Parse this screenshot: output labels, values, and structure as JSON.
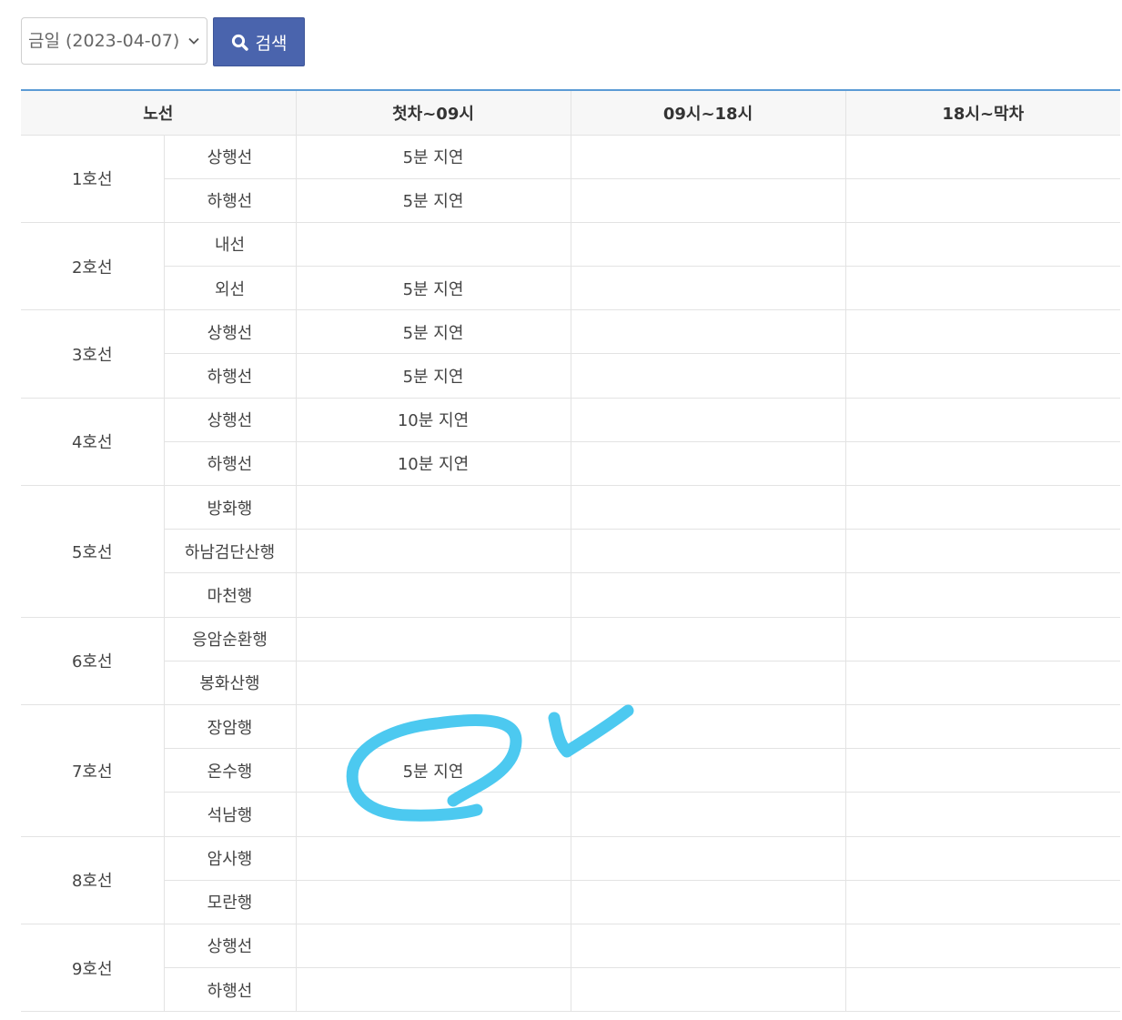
{
  "search": {
    "selected_value": "금일 (2023-04-07)",
    "button_label": "검색"
  },
  "table": {
    "headers": [
      "노선",
      "첫차~09시",
      "09시~18시",
      "18시~막차"
    ],
    "lines": [
      {
        "name": "1호선",
        "directions": [
          {
            "direction": "상행선",
            "first_to_09": "5분 지연",
            "h09_to_18": "",
            "h18_to_last": ""
          },
          {
            "direction": "하행선",
            "first_to_09": "5분 지연",
            "h09_to_18": "",
            "h18_to_last": ""
          }
        ]
      },
      {
        "name": "2호선",
        "directions": [
          {
            "direction": "내선",
            "first_to_09": "",
            "h09_to_18": "",
            "h18_to_last": ""
          },
          {
            "direction": "외선",
            "first_to_09": "5분 지연",
            "h09_to_18": "",
            "h18_to_last": ""
          }
        ]
      },
      {
        "name": "3호선",
        "directions": [
          {
            "direction": "상행선",
            "first_to_09": "5분 지연",
            "h09_to_18": "",
            "h18_to_last": ""
          },
          {
            "direction": "하행선",
            "first_to_09": "5분 지연",
            "h09_to_18": "",
            "h18_to_last": ""
          }
        ]
      },
      {
        "name": "4호선",
        "directions": [
          {
            "direction": "상행선",
            "first_to_09": "10분 지연",
            "h09_to_18": "",
            "h18_to_last": ""
          },
          {
            "direction": "하행선",
            "first_to_09": "10분 지연",
            "h09_to_18": "",
            "h18_to_last": ""
          }
        ]
      },
      {
        "name": "5호선",
        "directions": [
          {
            "direction": "방화행",
            "first_to_09": "",
            "h09_to_18": "",
            "h18_to_last": ""
          },
          {
            "direction": "하남검단산행",
            "first_to_09": "",
            "h09_to_18": "",
            "h18_to_last": ""
          },
          {
            "direction": "마천행",
            "first_to_09": "",
            "h09_to_18": "",
            "h18_to_last": ""
          }
        ]
      },
      {
        "name": "6호선",
        "directions": [
          {
            "direction": "응암순환행",
            "first_to_09": "",
            "h09_to_18": "",
            "h18_to_last": ""
          },
          {
            "direction": "봉화산행",
            "first_to_09": "",
            "h09_to_18": "",
            "h18_to_last": ""
          }
        ]
      },
      {
        "name": "7호선",
        "directions": [
          {
            "direction": "장암행",
            "first_to_09": "",
            "h09_to_18": "",
            "h18_to_last": ""
          },
          {
            "direction": "온수행",
            "first_to_09": "5분 지연",
            "h09_to_18": "",
            "h18_to_last": ""
          },
          {
            "direction": "석남행",
            "first_to_09": "",
            "h09_to_18": "",
            "h18_to_last": ""
          }
        ]
      },
      {
        "name": "8호선",
        "directions": [
          {
            "direction": "암사행",
            "first_to_09": "",
            "h09_to_18": "",
            "h18_to_last": ""
          },
          {
            "direction": "모란행",
            "first_to_09": "",
            "h09_to_18": "",
            "h18_to_last": ""
          }
        ]
      },
      {
        "name": "9호선",
        "directions": [
          {
            "direction": "상행선",
            "first_to_09": "",
            "h09_to_18": "",
            "h18_to_last": ""
          },
          {
            "direction": "하행선",
            "first_to_09": "",
            "h09_to_18": "",
            "h18_to_last": ""
          }
        ]
      }
    ]
  },
  "annotation": {
    "color": "#4cc9f0",
    "marks": [
      "circle-mark",
      "checkmark"
    ]
  }
}
